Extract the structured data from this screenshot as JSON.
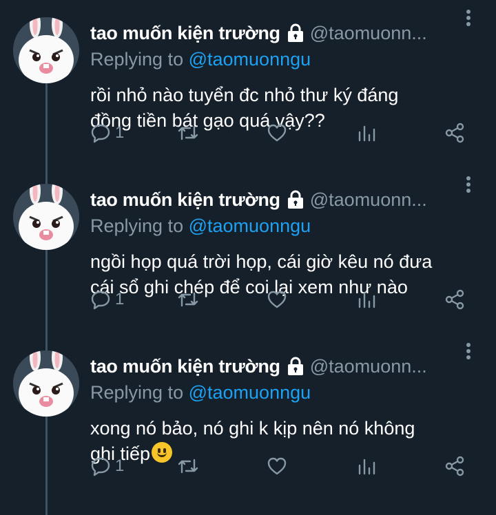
{
  "tweets": [
    {
      "name": "tao muốn kiện trường",
      "handle": "@taomuonn...",
      "replying_prefix": "Replying to",
      "replying_handle": "@taomuonngu",
      "text_lines": [
        "rồi nhỏ nào tuyển đc nhỏ thư ký đáng",
        "đồng tiền bát gạo quá vậy??"
      ],
      "reply_count": "1"
    },
    {
      "name": "tao muốn kiện trường",
      "handle": "@taomuonn...",
      "replying_prefix": "Replying to",
      "replying_handle": "@taomuonngu",
      "text_lines": [
        "ngồi họp quá trời họp, cái giờ kêu nó đưa",
        "cái sổ ghi chép để coi lại xem như nào"
      ],
      "reply_count": "1"
    },
    {
      "name": "tao muốn kiện trường",
      "handle": "@taomuonn...",
      "replying_prefix": "Replying to",
      "replying_handle": "@taomuonngu",
      "text_lines": [
        "xong nó bảo, nó ghi k kịp nên nó không",
        "ghi tiếp"
      ],
      "reply_count": "1",
      "emoji": "slightly-smiling-face"
    }
  ],
  "icons": {
    "lock": "lock-icon",
    "more": "more-vertical-icon",
    "reply": "reply-icon",
    "retweet": "retweet-icon",
    "like": "heart-icon",
    "analytics": "analytics-icon",
    "share": "share-icon"
  },
  "colors": {
    "background": "#15202b",
    "secondary_text": "#8899a6",
    "mention": "#1da1f2",
    "thread_line": "#3d5466"
  }
}
